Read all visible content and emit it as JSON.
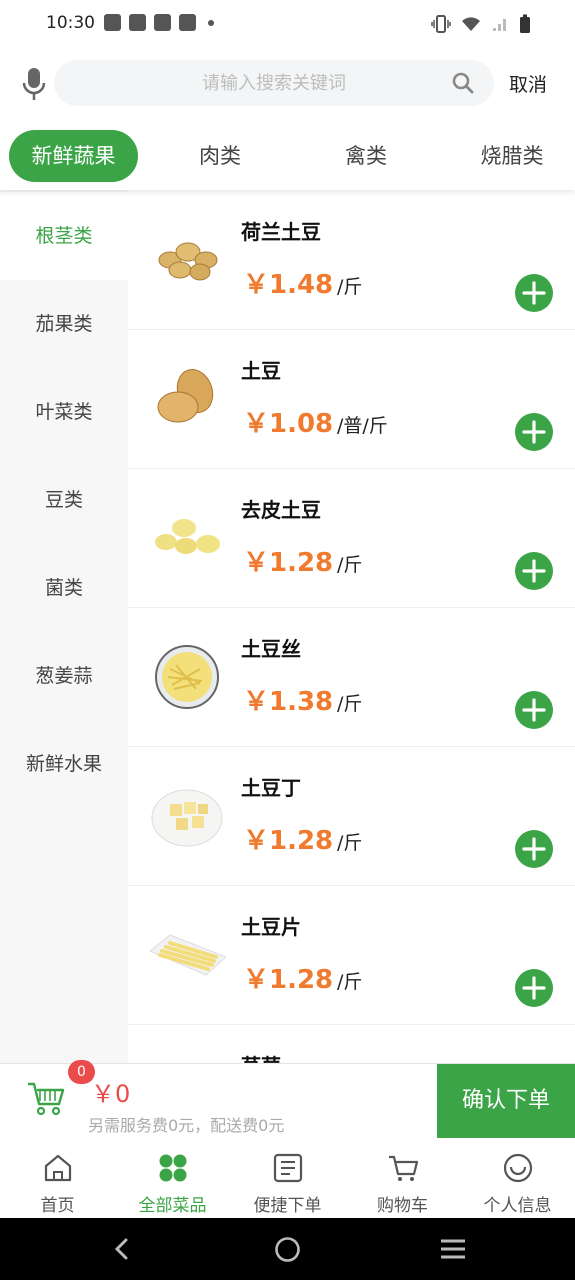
{
  "status_bar": {
    "time": "10:30"
  },
  "search": {
    "placeholder": "请输入搜索关键词",
    "value": "",
    "cancel_label": "取消"
  },
  "top_tabs": [
    {
      "label": "新鲜蔬果",
      "active": true
    },
    {
      "label": "肉类",
      "active": false
    },
    {
      "label": "禽类",
      "active": false
    },
    {
      "label": "烧腊类",
      "active": false
    }
  ],
  "sidebar": {
    "items": [
      {
        "label": "根茎类",
        "active": true
      },
      {
        "label": "茄果类",
        "active": false
      },
      {
        "label": "叶菜类",
        "active": false
      },
      {
        "label": "豆类",
        "active": false
      },
      {
        "label": "菌类",
        "active": false
      },
      {
        "label": "葱姜蒜",
        "active": false
      },
      {
        "label": "新鲜水果",
        "active": false
      }
    ]
  },
  "products": [
    {
      "name": "荷兰土豆",
      "price": "￥1.48",
      "unit": "/斤",
      "image": "whole-potatoes"
    },
    {
      "name": "土豆",
      "price": "￥1.08",
      "unit": "/普/斤",
      "image": "large-potatoes"
    },
    {
      "name": "去皮土豆",
      "price": "￥1.28",
      "unit": "/斤",
      "image": "peeled-potatoes"
    },
    {
      "name": "土豆丝",
      "price": "￥1.38",
      "unit": "/斤",
      "image": "shredded-potato"
    },
    {
      "name": "土豆丁",
      "price": "￥1.28",
      "unit": "/斤",
      "image": "diced-potato"
    },
    {
      "name": "土豆片",
      "price": "￥1.28",
      "unit": "/斤",
      "image": "sliced-potato"
    },
    {
      "name": "莴苣",
      "price": "",
      "unit": "",
      "image": ""
    }
  ],
  "cart": {
    "badge_count": "0",
    "total": "￥0",
    "fee_note": "另需服务费0元，配送费0元",
    "confirm_label": "确认下单"
  },
  "bottom_nav": [
    {
      "label": "首页",
      "icon": "home-icon",
      "active": false
    },
    {
      "label": "全部菜品",
      "icon": "grid-icon",
      "active": true
    },
    {
      "label": "便捷下单",
      "icon": "list-icon",
      "active": false
    },
    {
      "label": "购物车",
      "icon": "cart-icon",
      "active": false
    },
    {
      "label": "个人信息",
      "icon": "smile-icon",
      "active": false
    }
  ],
  "colors": {
    "accent": "#3ba447",
    "price": "#f07a2d",
    "badge": "#ea4b4b"
  }
}
